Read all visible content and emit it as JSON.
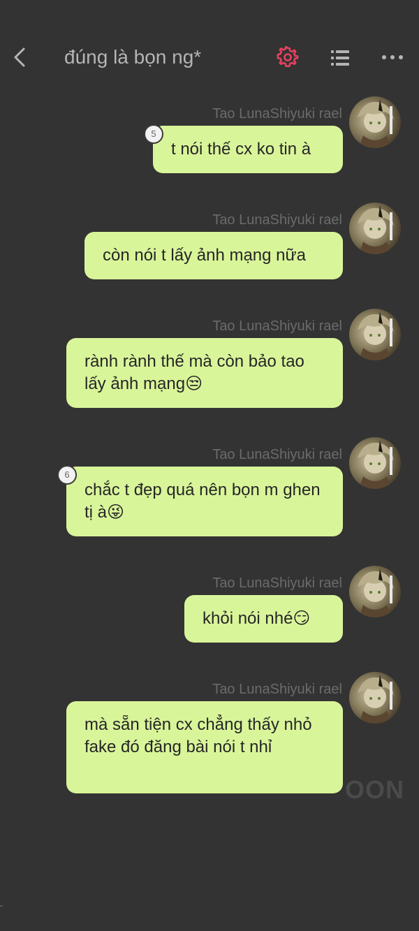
{
  "header": {
    "title": "đúng là bọn ng*",
    "icons": {
      "back": "chevron-left-icon",
      "settings": "gear-icon",
      "list": "list-icon",
      "more": "more-horizontal-icon"
    },
    "accent": "#e8415f"
  },
  "messages": [
    {
      "sender": "Tao LunaShiyuki rael",
      "text": "t nói thế cx ko tin à",
      "badge": "5"
    },
    {
      "sender": "Tao LunaShiyuki rael",
      "text": "còn nói t lấy ảnh mạng nữa",
      "badge": ""
    },
    {
      "sender": "Tao LunaShiyuki rael",
      "text": "rành rành thế mà còn bảo tao lấy ảnh mạng😒",
      "badge": ""
    },
    {
      "sender": "Tao LunaShiyuki rael",
      "text": "chắc t đẹp quá nên bọn m ghen tị à😜",
      "badge": "6"
    },
    {
      "sender": "Tao LunaShiyuki rael",
      "text": "khỏi nói nhé😏",
      "badge": ""
    },
    {
      "sender": "Tao LunaShiyuki rael",
      "text": "mà sẵn tiện cx chẳng thấy nhỏ fake đó đăng bài nói t nhỉ",
      "badge": ""
    }
  ],
  "watermark": "OON",
  "colors": {
    "background": "#333333",
    "bubble": "#d9f59a",
    "sender": "#6b6b6b",
    "title": "#b5b5b5"
  }
}
